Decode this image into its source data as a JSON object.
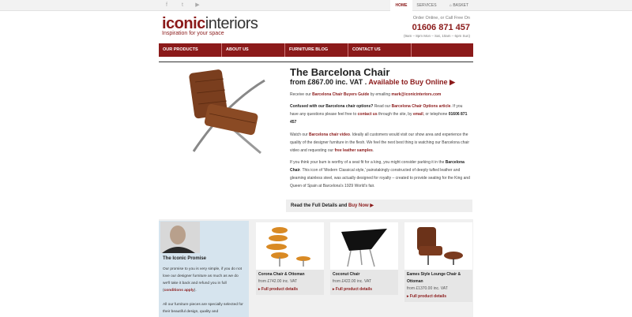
{
  "topbar": {
    "nav": [
      "HOME",
      "SERVICES",
      "BASKET"
    ]
  },
  "brand": {
    "logo_a": "iconic",
    "logo_b": "interiors",
    "tagline": "Inspiration for your space"
  },
  "contact": {
    "line1": "Order Online, or Call Free On",
    "phone": "01606 871 457",
    "hours": "(9am – 8pm Mon – Sat, 10am – 6pm Sun)"
  },
  "mainnav": [
    "OUR PRODUCTS",
    "ABOUT US",
    "FURNITURE BLOG",
    "CONTACT US"
  ],
  "product": {
    "title": "The Barcelona Chair",
    "price": "from £867.00 inc. VAT .",
    "buy": "Available to Buy Online"
  },
  "body": {
    "p1a": "Receive our",
    "p1b": "Barcelona Chair Buyers Guide",
    "p1c": "by emailing",
    "p1d": "mark@iconicinteriors.com",
    "p2a": "Confused with our Barcelona chair options?",
    "p2b": "Read our",
    "p2c": "Barcelona Chair Options article",
    "p2d": ". If you have any questions please feel free to",
    "p2e": "contact us",
    "p2f": "through the site, by",
    "p2g": "email",
    ",p2h": "",
    "p2i": ", or telephone",
    "p2j": "01606 871 457",
    "p3a": "Watch our",
    "p3b": "Barcelona chair video",
    "p3c": ". Ideally all customers would visit our show area and experience the quality of the designer furniture in the flesh. We feel the next best thing is watching our Barcelona chair video and requesting our",
    "p3d": "free leather samples",
    "p4a": "If you think your bum is worthy of a seat fit for a king, you might consider parking it in the",
    "p4b": "Barcelona Chair",
    "p4c": ". This icon of 'Modern Classical style,' painstakingly constructed of deeply tufted leather and gleaming stainless steel, was actually designed for royalty – created to provide seating for the King and Queen of Spain at Barcelona's 1929 World's fair."
  },
  "fullbar": {
    "a": "Read the Full Details and",
    "b": "Buy Now"
  },
  "promise": {
    "title": "The Iconic Promise",
    "t1": "Our promise to you is very simple, if you do not love our designer furniture as much as we do we'll take it back and refund you in full (",
    "t2": "conditions apply",
    "t3": ").",
    "t4": "All our furniture pieces are specially selected for their beautiful design, quality and"
  },
  "products": [
    {
      "name": "Corona Chair & Ottoman",
      "price": "from £742.00 inc. VAT",
      "link": "Full product details"
    },
    {
      "name": "Coconut Chair",
      "price": "from £422.00 inc. VAT",
      "link": "Full product details"
    },
    {
      "name": "Eames Style Lounge Chair & Ottoman",
      "price": "from £1370.00 inc. VAT",
      "link": "Full product details"
    }
  ],
  "colors": {
    "accent": "#8b1a1a"
  }
}
